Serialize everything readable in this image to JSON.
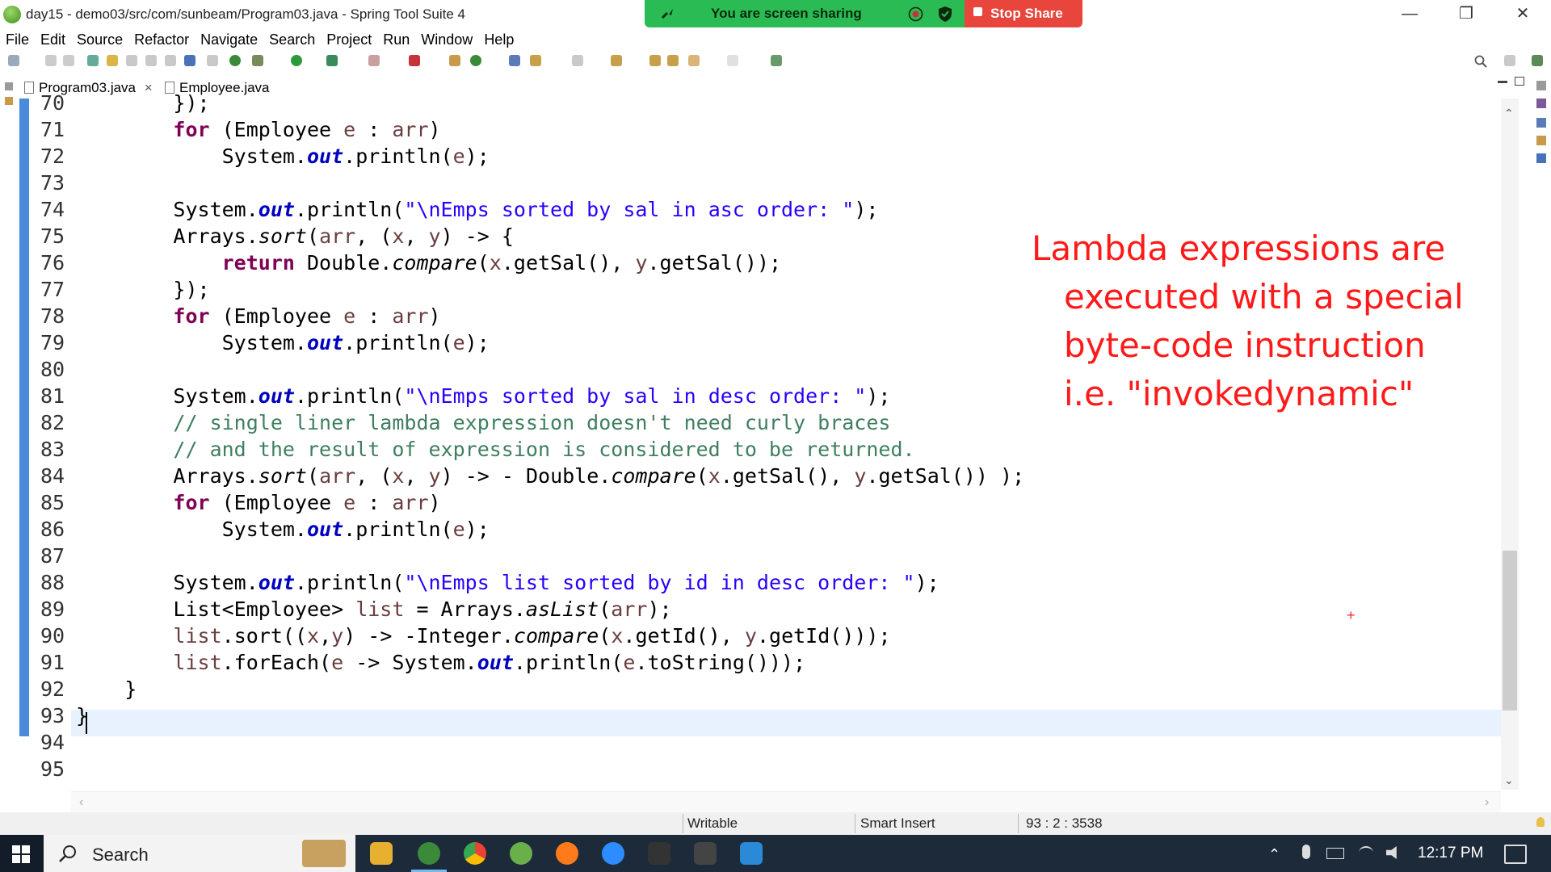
{
  "window": {
    "title": "day15 - demo03/src/com/sunbeam/Program03.java - Spring Tool Suite 4",
    "controls": [
      "—",
      "❐",
      "✕"
    ]
  },
  "screen_share": {
    "status_text": "You are screen sharing",
    "stop_label": "Stop Share",
    "colors": {
      "banner": "#2bbb55",
      "stop": "#e8453c"
    }
  },
  "menu": [
    "File",
    "Edit",
    "Source",
    "Refactor",
    "Navigate",
    "Search",
    "Project",
    "Run",
    "Window",
    "Help"
  ],
  "tabs": [
    {
      "label": "Program03.java",
      "active": true,
      "close": "×"
    },
    {
      "label": "Employee.java",
      "active": false
    }
  ],
  "editor": {
    "lines": [
      {
        "n": "70",
        "html": "        });"
      },
      {
        "n": "71",
        "html": "        <span class=\"kw\">for</span> (Employee <span class=\"var\">e</span> : <span class=\"var\">arr</span>)"
      },
      {
        "n": "72",
        "html": "            System.<span class=\"fld\">out</span>.println(<span class=\"var\">e</span>);"
      },
      {
        "n": "73",
        "html": ""
      },
      {
        "n": "74",
        "html": "        System.<span class=\"fld\">out</span>.println(<span class=\"str\">\"\\nEmps sorted by sal in asc order: \"</span>);"
      },
      {
        "n": "75",
        "html": "        Arrays.<span class=\"it\">sort</span>(<span class=\"var\">arr</span>, (<span class=\"var\">x</span>, <span class=\"var\">y</span>) -> {"
      },
      {
        "n": "76",
        "html": "            <span class=\"kw\">return</span> Double.<span class=\"it\">compare</span>(<span class=\"var\">x</span>.getSal(), <span class=\"var\">y</span>.getSal());"
      },
      {
        "n": "77",
        "html": "        });"
      },
      {
        "n": "78",
        "html": "        <span class=\"kw\">for</span> (Employee <span class=\"var\">e</span> : <span class=\"var\">arr</span>)"
      },
      {
        "n": "79",
        "html": "            System.<span class=\"fld\">out</span>.println(<span class=\"var\">e</span>);"
      },
      {
        "n": "80",
        "html": ""
      },
      {
        "n": "81",
        "html": "        System.<span class=\"fld\">out</span>.println(<span class=\"str\">\"\\nEmps sorted by sal in desc order: \"</span>);"
      },
      {
        "n": "82",
        "html": "        <span class=\"cm\">// single liner lambda expression doesn't need curly braces</span>"
      },
      {
        "n": "83",
        "html": "        <span class=\"cm\">// and the result of expression is considered to be returned.</span>"
      },
      {
        "n": "84",
        "html": "        Arrays.<span class=\"it\">sort</span>(<span class=\"var\">arr</span>, (<span class=\"var\">x</span>, <span class=\"var\">y</span>) -> - Double.<span class=\"it\">compare</span>(<span class=\"var\">x</span>.getSal(), <span class=\"var\">y</span>.getSal()) );"
      },
      {
        "n": "85",
        "html": "        <span class=\"kw\">for</span> (Employee <span class=\"var\">e</span> : <span class=\"var\">arr</span>)"
      },
      {
        "n": "86",
        "html": "            System.<span class=\"fld\">out</span>.println(<span class=\"var\">e</span>);"
      },
      {
        "n": "87",
        "html": ""
      },
      {
        "n": "88",
        "html": "        System.<span class=\"fld\">out</span>.println(<span class=\"str\">\"\\nEmps list sorted by id in desc order: \"</span>);"
      },
      {
        "n": "89",
        "html": "        List&lt;Employee&gt; <span class=\"var\">list</span> = Arrays.<span class=\"it\">asList</span>(<span class=\"var\">arr</span>);"
      },
      {
        "n": "90",
        "html": "        <span class=\"var\">list</span>.sort((<span class=\"var\">x</span>,<span class=\"var\">y</span>) -> -Integer.<span class=\"it\">compare</span>(<span class=\"var\">x</span>.getId(), <span class=\"var\">y</span>.getId()));"
      },
      {
        "n": "91",
        "html": "        <span class=\"var\">list</span>.forEach(<span class=\"var\">e</span> -> System.<span class=\"fld\">out</span>.println(<span class=\"var\">e</span>.toString()));"
      },
      {
        "n": "92",
        "html": "    }"
      },
      {
        "n": "93",
        "html": "}"
      },
      {
        "n": "94",
        "html": ""
      },
      {
        "n": "95",
        "html": ""
      }
    ]
  },
  "annotation": {
    "lines": [
      "Lambda expressions are",
      "executed with a special",
      "byte-code instruction",
      "i.e. \"invokedynamic\""
    ],
    "color": "#ff1a1a",
    "plus_mark": "+"
  },
  "status_bar": {
    "mode": "Writable",
    "insert": "Smart Insert",
    "position": "93 : 2 : 3538"
  },
  "taskbar": {
    "search_label": "Search",
    "clock": "12:17 PM"
  }
}
